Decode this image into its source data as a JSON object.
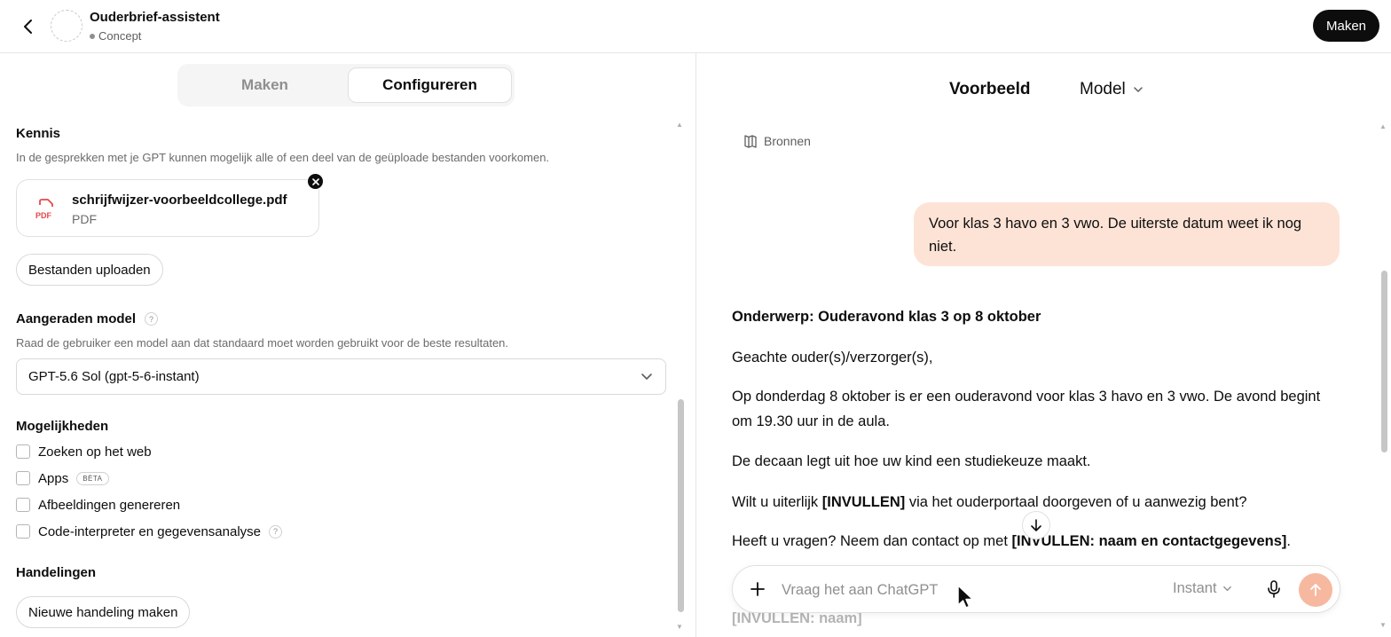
{
  "header": {
    "title": "Ouderbrief-assistent",
    "status": "Concept",
    "make_button": "Maken"
  },
  "left": {
    "tabs": {
      "maken": "Maken",
      "configureren": "Configureren",
      "active": "Configureren"
    },
    "knowledge": {
      "heading": "Kennis",
      "description": "In de gesprekken met je GPT kunnen mogelijk alle of een deel van de geüploade bestanden voorkomen.",
      "file": {
        "name": "schrijfwijzer-voorbeeldcollege.pdf",
        "type": "PDF",
        "icon_label": "PDF"
      },
      "upload_button": "Bestanden uploaden"
    },
    "recommended_model": {
      "heading": "Aangeraden model",
      "help": "?",
      "description": "Raad de gebruiker een model aan dat standaard moet worden gebruikt voor de beste resultaten.",
      "selected": "GPT-5.6 Sol (gpt-5-6-instant)"
    },
    "capabilities": {
      "heading": "Mogelijkheden",
      "items": [
        {
          "label": "Zoeken op het web",
          "checked": false
        },
        {
          "label": "Apps",
          "badge": "BÈTA",
          "checked": false
        },
        {
          "label": "Afbeeldingen genereren",
          "checked": false
        },
        {
          "label": "Code-interpreter en gegevensanalyse",
          "help": "?",
          "checked": false
        }
      ]
    },
    "actions": {
      "heading": "Handelingen",
      "new_action_button": "Nieuwe handeling maken"
    }
  },
  "right": {
    "preview_title": "Voorbeeld",
    "model_label": "Model",
    "sources_label": "Bronnen",
    "user_message": "Voor klas 3 havo en 3 vwo. De uiterste datum weet ik nog niet.",
    "assistant": {
      "subject": "Onderwerp: Ouderavond klas 3 op 8 oktober",
      "greeting": "Geachte ouder(s)/verzorger(s),",
      "p1": "Op donderdag 8 oktober is er een ouderavond voor klas 3 havo en 3 vwo. De avond begint om 19.30 uur in de aula.",
      "p2": "De decaan legt uit hoe uw kind een studiekeuze maakt.",
      "p3_pre": "Wilt u uiterlijk ",
      "p3_bold": "[INVULLEN]",
      "p3_post": " via het ouderportaal doorgeven of u aanwezig bent?",
      "p4_pre": "Heeft u vragen? Neem dan contact op met ",
      "p4_bold": "[INVULLEN: naam en contactgegevens]",
      "p4_post": ".",
      "faded_last": "[INVULLEN: naam]"
    },
    "composer": {
      "placeholder": "Vraag het aan ChatGPT",
      "mode": "Instant"
    }
  },
  "colors": {
    "user_bubble": "#fde3d6",
    "send_button": "#f7b8a0",
    "primary_dark": "#0d0d0d",
    "pdf_red": "#e5484d"
  }
}
